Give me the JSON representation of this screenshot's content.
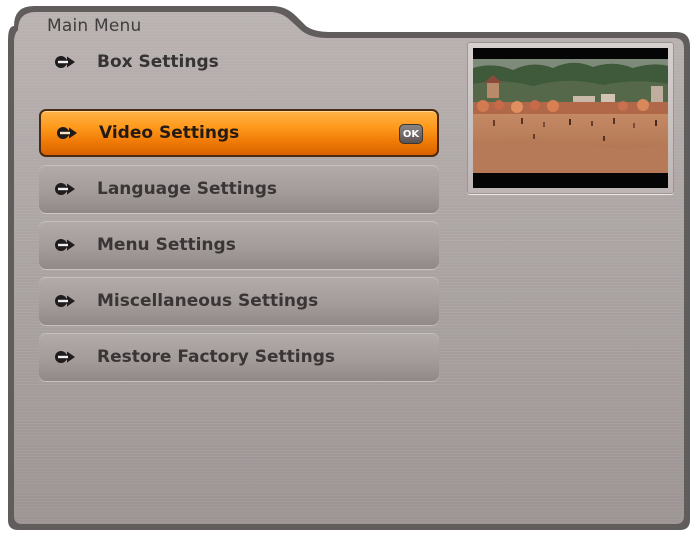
{
  "breadcrumb": "Main Menu",
  "title": "Box Settings",
  "menu": {
    "items": [
      {
        "label": "Video Settings",
        "selected": true,
        "badge": "OK"
      },
      {
        "label": "Language Settings",
        "selected": false
      },
      {
        "label": "Menu Settings",
        "selected": false
      },
      {
        "label": "Miscellaneous Settings",
        "selected": false
      },
      {
        "label": "Restore Factory Settings",
        "selected": false
      }
    ]
  },
  "colors": {
    "panel": "#aea7a6",
    "selected": "#f58a0e",
    "item": "#a49c9b",
    "text": "#3a3636",
    "frame": "#5e5a59"
  },
  "icons": {
    "item_marker": "arrow-right-icon"
  }
}
